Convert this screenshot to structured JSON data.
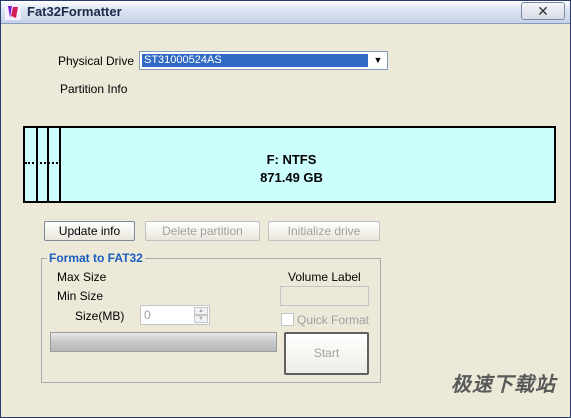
{
  "window": {
    "title": "Fat32Formatter",
    "close_label": "✕"
  },
  "drive": {
    "physical_drive_label": "Physical Drive",
    "selected": "ST31000524AS",
    "partition_info_label": "Partition Info"
  },
  "partition": {
    "name": "F: NTFS",
    "size": "871.49 GB"
  },
  "buttons": {
    "update": "Update info",
    "delete": "Delete partition",
    "initialize": "Initialize drive"
  },
  "format": {
    "group_title": "Format to FAT32",
    "max_size_label": "Max Size",
    "min_size_label": "Min Size",
    "size_label": "Size(MB)",
    "size_value": "0",
    "volume_label": "Volume Label",
    "volume_value": "",
    "quick_format_label": "Quick Format",
    "quick_format_checked": false,
    "progress": 0,
    "start_label": "Start"
  },
  "watermark": "极速下载站"
}
